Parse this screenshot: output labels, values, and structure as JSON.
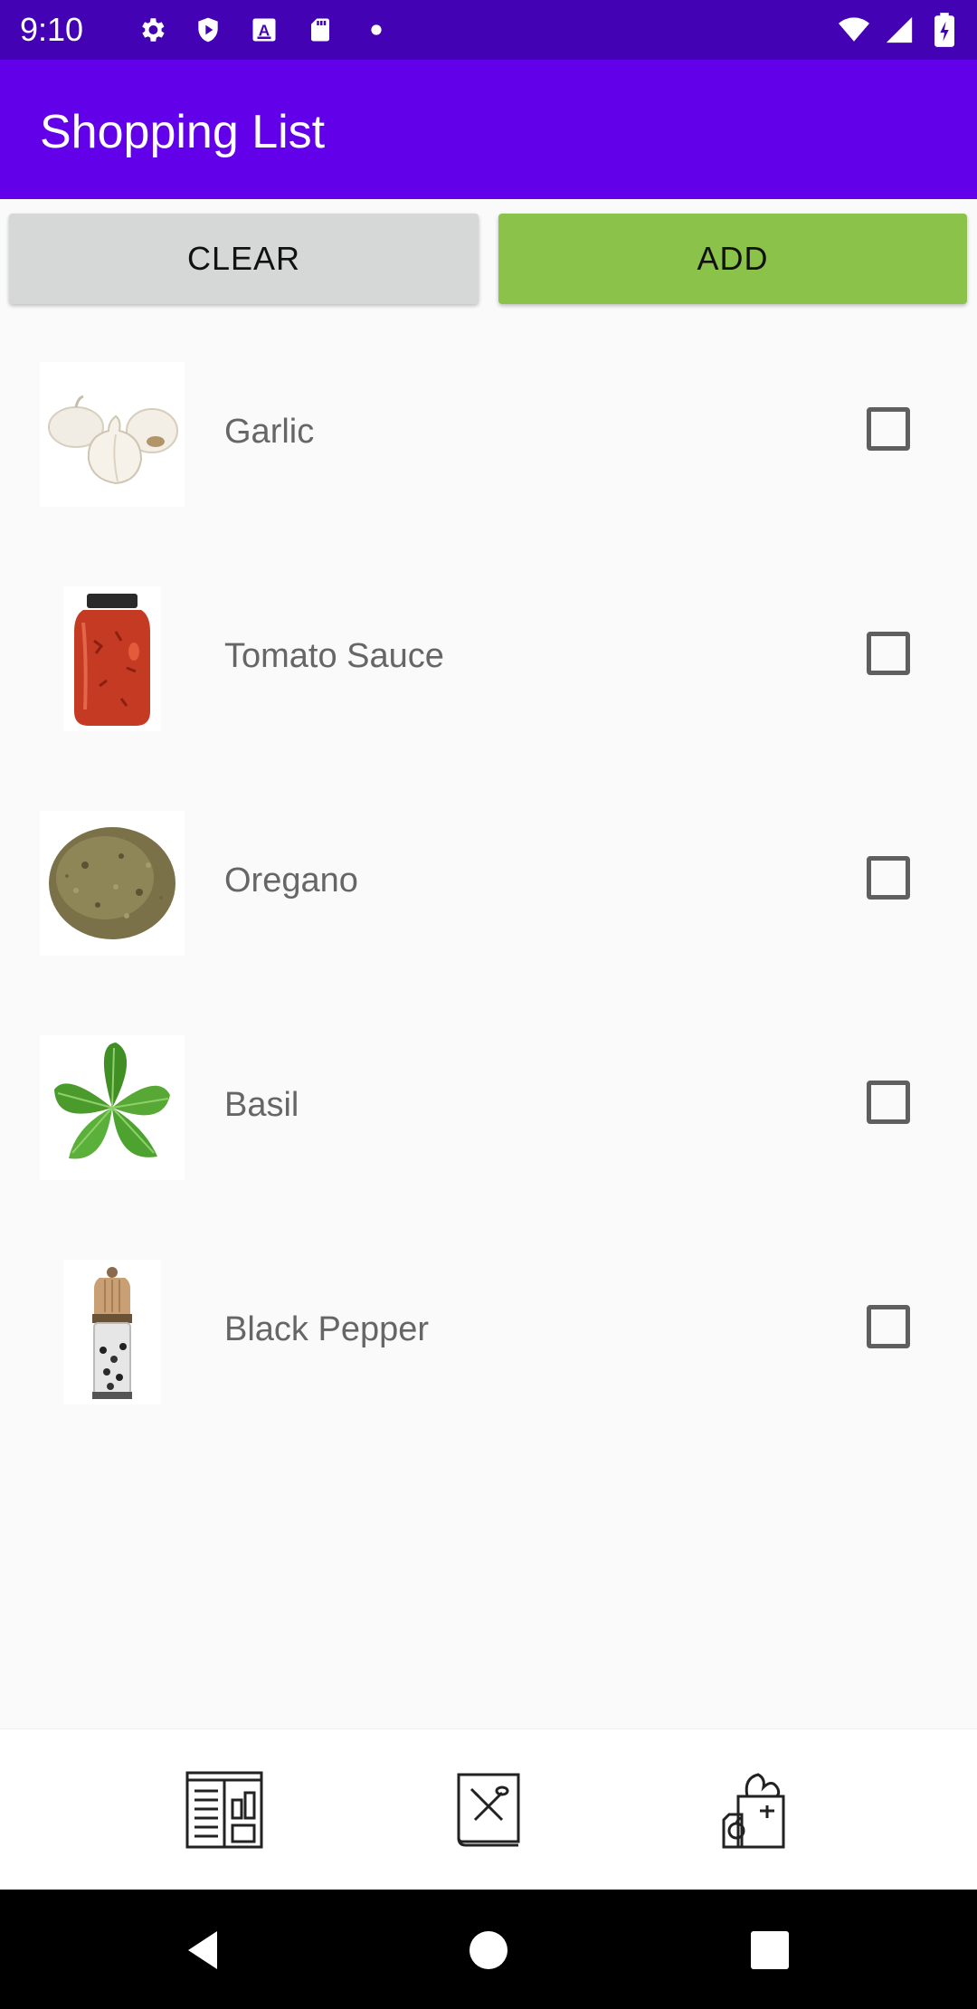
{
  "status_bar": {
    "time": "9:10",
    "left_icons": [
      "gear-icon",
      "shield-icon",
      "a-box-icon",
      "sd-card-icon",
      "dot-icon"
    ],
    "right_icons": [
      "wifi-icon",
      "signal-icon",
      "battery-icon"
    ]
  },
  "app_bar": {
    "title": "Shopping List",
    "color": "#6200ea"
  },
  "buttons": {
    "clear_label": "CLEAR",
    "add_label": "ADD",
    "clear_color": "#d6d7d7",
    "add_color": "#8bc34a"
  },
  "items": [
    {
      "label": "Garlic",
      "image": "garlic-image",
      "checked": false
    },
    {
      "label": "Tomato Sauce",
      "image": "tomato-sauce-image",
      "checked": false
    },
    {
      "label": "Oregano",
      "image": "oregano-image",
      "checked": false
    },
    {
      "label": "Basil",
      "image": "basil-image",
      "checked": false
    },
    {
      "label": "Black Pepper",
      "image": "black-pepper-image",
      "checked": false
    }
  ],
  "bottom_nav": {
    "items": [
      "pantry-icon",
      "recipe-book-icon",
      "groceries-icon"
    ]
  },
  "system_nav": [
    "back-icon",
    "home-icon",
    "recents-icon"
  ]
}
